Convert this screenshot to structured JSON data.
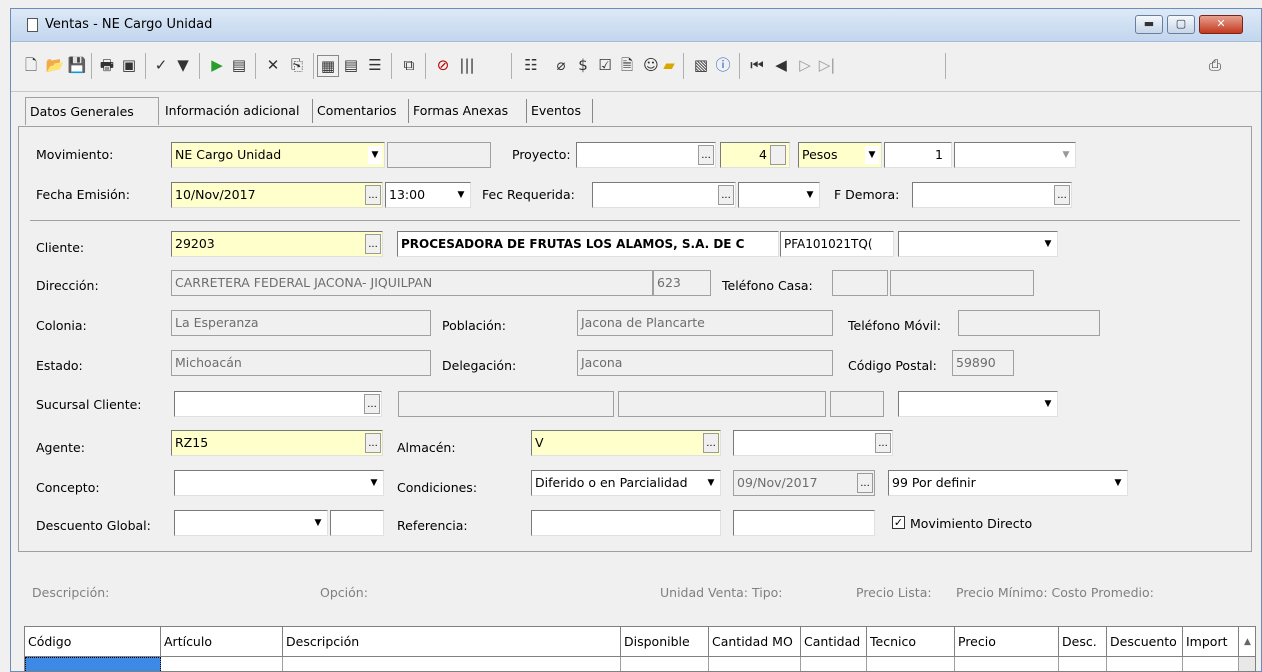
{
  "window": {
    "title": "Ventas - NE Cargo Unidad",
    "min": "▬",
    "max": "▢",
    "close": "✕"
  },
  "toolbar": {
    "icons": [
      "new-icon",
      "open-icon",
      "save-icon",
      "print-icon",
      "preview-icon",
      "spell-icon",
      "filter-icon",
      "play-icon",
      "cfd-icon",
      "delete-icon",
      "copy-doc-icon",
      "grid-icon",
      "form-icon",
      "list-icon",
      "clone-icon",
      "cancel-icon",
      "barcode-icon",
      "bullets-icon",
      "attach-icon",
      "money-icon",
      "check-icon",
      "doc-icon",
      "users-icon",
      "folder-icon",
      "props-icon",
      "info-icon",
      "first-icon",
      "prev-icon",
      "next-icon",
      "last-icon",
      "export-icon"
    ]
  },
  "tabs": [
    "Datos Generales",
    "Información adicional",
    "Comentarios",
    "Formas Anexas",
    "Eventos"
  ],
  "form": {
    "movimiento_label": "Movimiento:",
    "movimiento": "NE Cargo Unidad",
    "proyecto_label": "Proyecto:",
    "proyecto_num": "4",
    "moneda": "Pesos",
    "tipo_cambio": "1",
    "fecha_label": "Fecha Emisión:",
    "fecha": "10/Nov/2017",
    "hora": "13:00",
    "fec_req_label": "Fec Requerida:",
    "f_demora_label": "F Demora:",
    "cliente_label": "Cliente:",
    "cliente": "29203",
    "cliente_nombre": "PROCESADORA DE FRUTAS LOS ALAMOS, S.A. DE C",
    "rfc": "PFA101021TQ(",
    "direccion_label": "Dirección:",
    "direccion": "CARRETERA FEDERAL JACONA- JIQUILPAN",
    "num": "623",
    "tel_casa_label": "Teléfono Casa:",
    "colonia_label": "Colonia:",
    "colonia": "La Esperanza",
    "poblacion_label": "Población:",
    "poblacion": "Jacona de Plancarte",
    "tel_movil_label": "Teléfono Móvil:",
    "estado_label": "Estado:",
    "estado": "Michoacán",
    "delegacion_label": "Delegación:",
    "delegacion": "Jacona",
    "cp_label": "Código Postal:",
    "cp": "59890",
    "sucursal_label": "Sucursal Cliente:",
    "agente_label": "Agente:",
    "agente": "RZ15",
    "almacen_label": "Almacén:",
    "almacen": "V",
    "concepto_label": "Concepto:",
    "condiciones_label": "Condiciones:",
    "condiciones": "Diferido o en Parcialidad",
    "cond_fecha": "09/Nov/2017",
    "cond_extra": "99 Por definir",
    "descuento_label": "Descuento  Global:",
    "referencia_label": "Referencia:",
    "mov_directo": "Movimiento Directo",
    "mov_directo_checked": true
  },
  "info_bar": {
    "descripcion": "Descripción:",
    "opcion": "Opción:",
    "unidad": "Unidad Venta: Tipo:",
    "precio_lista": "Precio Lista:",
    "precio_min": "Precio Mínimo: Costo Promedio:"
  },
  "grid": {
    "columns": [
      "Código",
      "Artículo",
      "Descripción",
      "Disponible",
      "Cantidad MO",
      "Cantidad",
      "Tecnico",
      "Precio",
      "Desc.",
      "Descuento",
      "Import"
    ]
  }
}
